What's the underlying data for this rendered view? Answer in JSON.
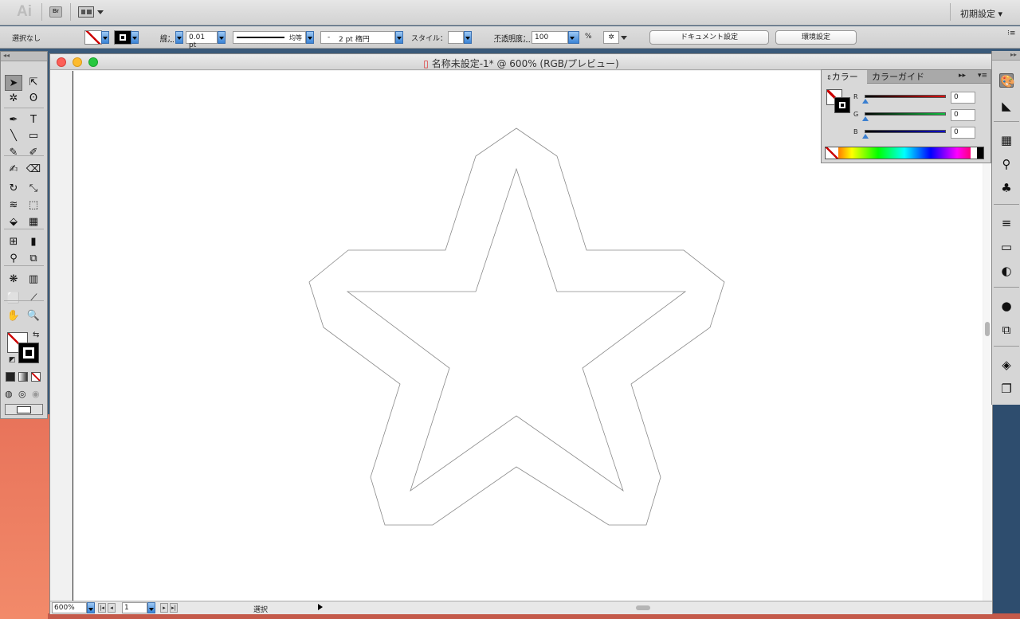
{
  "app": {
    "logo": "Ai",
    "bridge": "Br",
    "workspace": "初期設定 ▾"
  },
  "control": {
    "selection": "選択なし",
    "stroke_label": "線：",
    "stroke_weight": "0.01 pt",
    "profile_label": "均等",
    "brush_label": "2 pt 楕円",
    "brush_dash": "-",
    "style_label": "スタイル：",
    "opacity_label": "不透明度：",
    "opacity_value": "100",
    "opacity_unit": "%",
    "doc_settings": "ドキュメント設定",
    "prefs": "環境設定"
  },
  "document": {
    "title": "名称未設定-1* @ 600% (RGB/プレビュー)"
  },
  "status": {
    "zoom": "600%",
    "page": "1",
    "tool": "選択"
  },
  "color_panel": {
    "tab_color": "カラー",
    "tab_guide": "カラーガイド",
    "channels": [
      {
        "name": "R",
        "value": "0",
        "color": "#e01010"
      },
      {
        "name": "G",
        "value": "0",
        "color": "#10c040"
      },
      {
        "name": "B",
        "value": "0",
        "color": "#1010d0"
      }
    ]
  },
  "tools": [
    "selection-tool",
    "direct-selection-tool",
    "magic-wand-tool",
    "lasso-tool",
    "pen-tool",
    "type-tool",
    "line-tool",
    "rectangle-tool",
    "paintbrush-tool",
    "pencil-tool",
    "blob-brush-tool",
    "eraser-tool",
    "rotate-tool",
    "scale-tool",
    "warp-tool",
    "free-transform-tool",
    "shape-builder-tool",
    "perspective-grid-tool",
    "mesh-tool",
    "gradient-tool",
    "eyedropper-tool",
    "blend-tool",
    "symbol-sprayer-tool",
    "column-graph-tool",
    "artboard-tool",
    "slice-tool",
    "hand-tool",
    "zoom-tool"
  ],
  "tool_glyphs": [
    "➤",
    "⇱",
    "✲",
    "ʘ",
    "✒",
    "T",
    "╲",
    "▭",
    "✎",
    "✐",
    "✍",
    "⌫",
    "↻",
    "⤡",
    "≋",
    "⬚",
    "⬙",
    "▦",
    "⊞",
    "▮",
    "⚲",
    "⧉",
    "❋",
    "▥",
    "⬜",
    "⟋",
    "✋",
    "🔍"
  ]
}
